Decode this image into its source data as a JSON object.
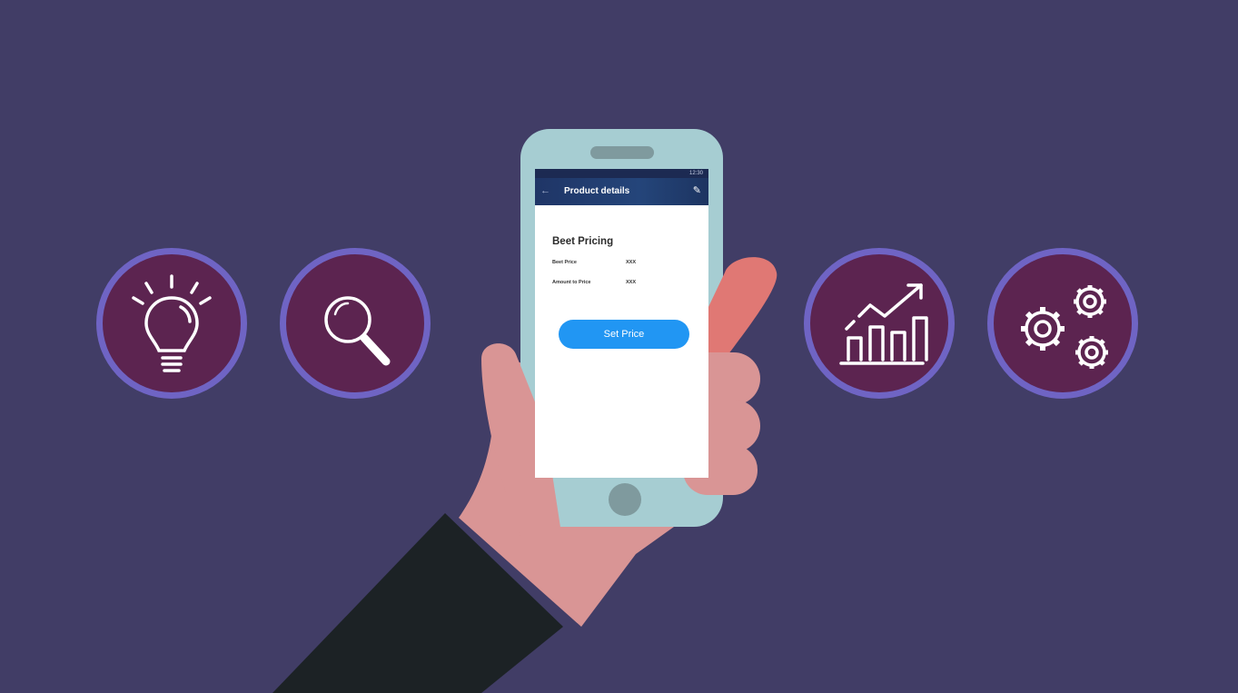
{
  "colors": {
    "background": "#413d66",
    "badge_fill": "#5c2450",
    "badge_ring": "#6f64c4",
    "phone_body": "#a6cdd2",
    "hand": "#d99595",
    "sleeve": "#1c2225",
    "button": "#2196f3"
  },
  "icons": [
    "lightbulb-icon",
    "magnifier-icon",
    "growth-chart-icon",
    "gears-icon"
  ],
  "phone": {
    "status_time": "12:30",
    "app_bar": {
      "back_icon": "←",
      "title": "Product details",
      "edit_icon": "✎"
    },
    "section_title": "Beet Pricing",
    "rows": [
      {
        "label": "Beet Price",
        "value": "XXX"
      },
      {
        "label": "Amount to Price",
        "value": "XXX"
      }
    ],
    "button_label": "Set Price"
  }
}
